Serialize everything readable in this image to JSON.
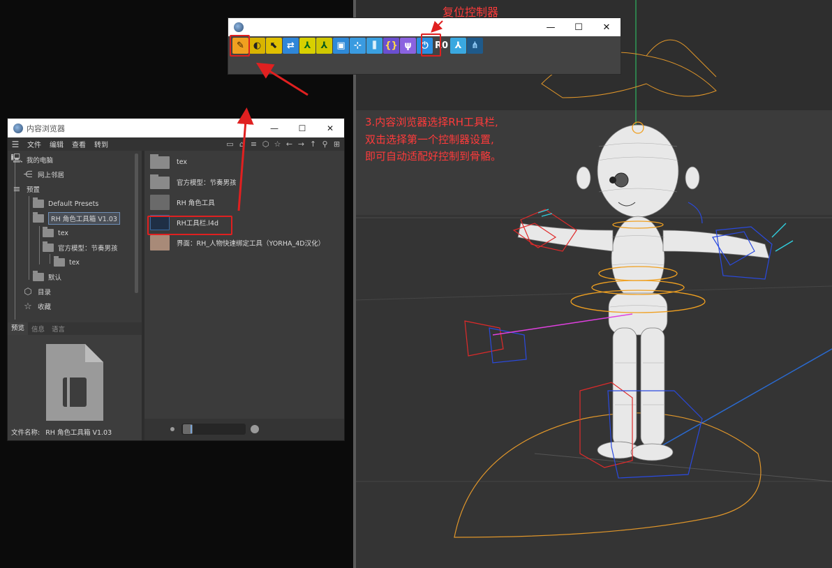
{
  "toolbar_window": {
    "icons": [
      {
        "name": "rh-settings-icon",
        "glyph": "✎",
        "bg": "#f0a020",
        "fg": "#3a2000"
      },
      {
        "name": "rh-eye-icon",
        "glyph": "◐",
        "bg": "#d8b400",
        "fg": "#222"
      },
      {
        "name": "rh-select-icon",
        "glyph": "⬉",
        "bg": "#e0c000",
        "fg": "#222"
      },
      {
        "name": "rh-transform-icon",
        "glyph": "⇄",
        "bg": "#2f86d8",
        "fg": "#fff"
      },
      {
        "name": "rh-figure-icon",
        "glyph": "⅄",
        "bg": "#d8d000",
        "fg": "#0a6a1a"
      },
      {
        "name": "rh-figure2-icon",
        "glyph": "⅄",
        "bg": "#d0c800",
        "fg": "#0a5a1a"
      },
      {
        "name": "rh-frame-icon",
        "glyph": "▣",
        "bg": "#2f8ad8",
        "fg": "#fff"
      },
      {
        "name": "rh-joint-icon",
        "glyph": "⊹",
        "bg": "#3a9be0",
        "fg": "#fff"
      },
      {
        "name": "rh-mirror-icon",
        "glyph": "⫼",
        "bg": "#3aa0e0",
        "fg": "#fff"
      },
      {
        "name": "rh-brace-icon",
        "glyph": "{}",
        "bg": "#6a4fd0",
        "fg": "#ffd84a"
      },
      {
        "name": "rh-lungs-icon",
        "glyph": "ψ",
        "bg": "#8a63e0",
        "fg": "#fff"
      },
      {
        "name": "rh-reset-controller-icon",
        "glyph": "⏻",
        "bg": "#2a8ee0",
        "fg": "#fff"
      },
      {
        "name": "rh-r0-icon",
        "glyph": "R0",
        "bg": "#434343",
        "fg": "#ffffff"
      },
      {
        "name": "rh-pose-icon",
        "glyph": "⅄",
        "bg": "#3aa8e0",
        "fg": "#fff"
      },
      {
        "name": "rh-node-icon",
        "glyph": "⋔",
        "bg": "#1f5a8a",
        "fg": "#9ad4ff"
      }
    ],
    "minimize": "—",
    "maximize": "☐",
    "close": "✕"
  },
  "content_browser": {
    "title": "内容浏览器",
    "menu": [
      "文件",
      "编辑",
      "查看",
      "转到"
    ],
    "tools": [
      "▭",
      "⌂",
      "≡",
      "⬡",
      "☆",
      "←",
      "→",
      "↑",
      "⚲",
      "⊞"
    ],
    "tree": [
      {
        "label": "我的电脑",
        "icon": "🖥"
      },
      {
        "label": "网上邻居",
        "icon": "⋲"
      },
      {
        "label": "预置",
        "icon": "≡"
      },
      {
        "label": "Default Presets"
      },
      {
        "label": "RH 角色工具箱 V1.03"
      },
      {
        "label": "tex"
      },
      {
        "label": "官方模型：节奏男孩"
      },
      {
        "label": "tex"
      },
      {
        "label": "默认"
      },
      {
        "label": "目录",
        "icon": "⬡"
      },
      {
        "label": "收藏",
        "icon": "☆"
      }
    ],
    "preview_tabs": [
      "预览",
      "信息",
      "语言"
    ],
    "file_name_label": "文件名称:",
    "file_name_value": "RH 角色工具箱 V1.03",
    "items": [
      {
        "label": "tex"
      },
      {
        "label": "官方模型：节奏男孩"
      },
      {
        "label": "RH 角色工具"
      },
      {
        "label": "RH工具栏.l4d"
      },
      {
        "label": "界面：RH_人物快速绑定工具（YORHA_4D汉化）"
      }
    ]
  },
  "annotations": {
    "reset_controller": "复位控制器",
    "instructions": [
      "3.内容浏览器选择RH工具栏,",
      "双击选择第一个控制器设置,",
      "即可自动适配好控制到骨骼。"
    ]
  }
}
